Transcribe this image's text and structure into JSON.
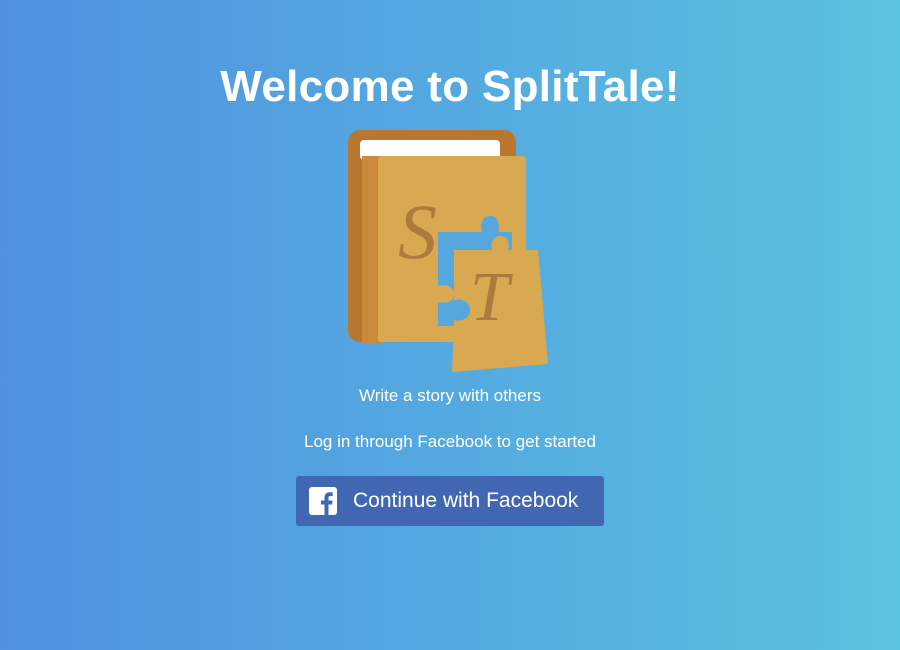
{
  "header": {
    "title": "Welcome to SplitTale!"
  },
  "logo": {
    "icon": "book-puzzle-logo",
    "letters": [
      "S",
      "T"
    ],
    "colors": {
      "cover": "#c98a3c",
      "page": "#d9a952",
      "spine": "#b0702d",
      "letter": "#9c6a2c"
    }
  },
  "main": {
    "tagline": "Write a story with others",
    "login_hint": "Log in through Facebook to get started",
    "facebook_button_label": "Continue with Facebook",
    "facebook_icon": "facebook-icon"
  },
  "colors": {
    "facebook_blue": "#4267b2",
    "background_start": "#4f91df",
    "background_end": "#5ac3dd"
  }
}
